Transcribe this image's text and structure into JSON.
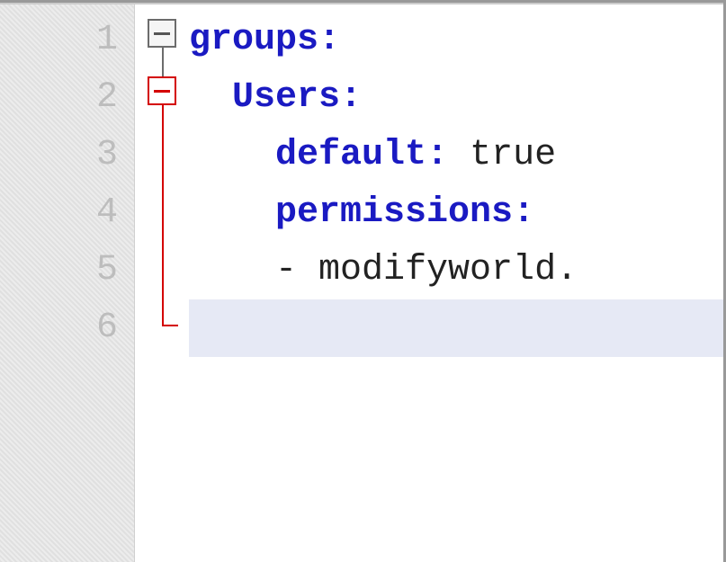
{
  "gutter": {
    "lines": [
      "1",
      "2",
      "3",
      "4",
      "5",
      "6"
    ]
  },
  "code": {
    "lines": [
      {
        "indent": "",
        "key": "groups",
        "colon": ":",
        "value": ""
      },
      {
        "indent": "  ",
        "key": "Users",
        "colon": ":",
        "value": ""
      },
      {
        "indent": "    ",
        "key": "default",
        "colon": ":",
        "value": " true"
      },
      {
        "indent": "    ",
        "key": "permissions",
        "colon": ":",
        "value": ""
      },
      {
        "indent": "    ",
        "key": "",
        "colon": "",
        "value": "- modifyworld."
      },
      {
        "indent": "",
        "key": "",
        "colon": "",
        "value": ""
      }
    ],
    "current_line": 6
  },
  "fold": {
    "markers": [
      {
        "line": 1,
        "state": "open",
        "color": "gray"
      },
      {
        "line": 2,
        "state": "open",
        "color": "red"
      }
    ]
  }
}
